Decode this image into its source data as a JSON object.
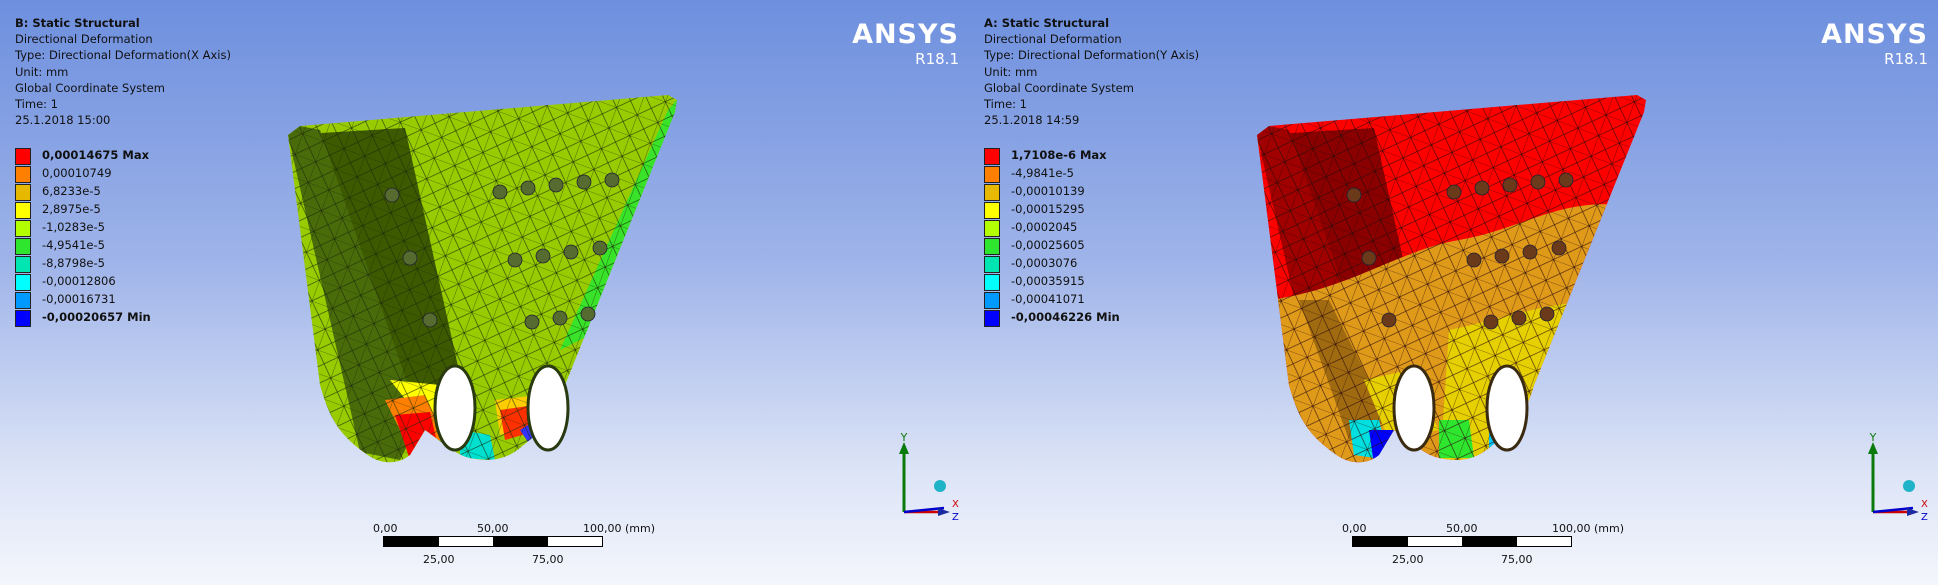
{
  "viewports": [
    {
      "info": {
        "title": "B: Static Structural",
        "result": "Directional Deformation",
        "type": "Type: Directional Deformation(X Axis)",
        "unit": "Unit: mm",
        "coords": "Global Coordinate System",
        "time": "Time: 1",
        "timestamp": "25.1.2018 15:00"
      },
      "legend": [
        {
          "label": "0,00014675 Max",
          "color": "#ff0000",
          "bold": true
        },
        {
          "label": "0,00010749",
          "color": "#ff8000",
          "bold": false
        },
        {
          "label": "6,8233e-5",
          "color": "#e6b800",
          "bold": false
        },
        {
          "label": "2,8975e-5",
          "color": "#ffff00",
          "bold": false
        },
        {
          "label": "-1,0283e-5",
          "color": "#b3ff00",
          "bold": false
        },
        {
          "label": "-4,9541e-5",
          "color": "#2ee62e",
          "bold": false
        },
        {
          "label": "-8,8798e-5",
          "color": "#00e6b3",
          "bold": false
        },
        {
          "label": "-0,00012806",
          "color": "#00ffff",
          "bold": false
        },
        {
          "label": "-0,00016731",
          "color": "#0099ff",
          "bold": false
        },
        {
          "label": "-0,00020657 Min",
          "color": "#0000ff",
          "bold": true
        }
      ]
    },
    {
      "info": {
        "title": "A: Static Structural",
        "result": "Directional Deformation",
        "type": "Type: Directional Deformation(Y Axis)",
        "unit": "Unit: mm",
        "coords": "Global Coordinate System",
        "time": "Time: 1",
        "timestamp": "25.1.2018 14:59"
      },
      "legend": [
        {
          "label": "1,7108e-6 Max",
          "color": "#ff0000",
          "bold": true
        },
        {
          "label": "-4,9841e-5",
          "color": "#ff8000",
          "bold": false
        },
        {
          "label": "-0,00010139",
          "color": "#e6b800",
          "bold": false
        },
        {
          "label": "-0,00015295",
          "color": "#ffff00",
          "bold": false
        },
        {
          "label": "-0,0002045",
          "color": "#b3ff00",
          "bold": false
        },
        {
          "label": "-0,00025605",
          "color": "#2ee62e",
          "bold": false
        },
        {
          "label": "-0,0003076",
          "color": "#00e6b3",
          "bold": false
        },
        {
          "label": "-0,00035915",
          "color": "#00ffff",
          "bold": false
        },
        {
          "label": "-0,00041071",
          "color": "#0099ff",
          "bold": false
        },
        {
          "label": "-0,00046226 Min",
          "color": "#0000ff",
          "bold": true
        }
      ]
    }
  ],
  "logo": {
    "name": "ANSYS",
    "version": "R18.1"
  },
  "scale": {
    "top_labels": [
      "0,00",
      "50,00",
      "100,00 (mm)"
    ],
    "bottom_labels": [
      "25,00",
      "75,00"
    ]
  },
  "triad": {
    "y_label": "Y",
    "x_label": "X",
    "z_label": "Z"
  },
  "icons": [
    "coordinate-triad-icon",
    "ansys-logo"
  ]
}
